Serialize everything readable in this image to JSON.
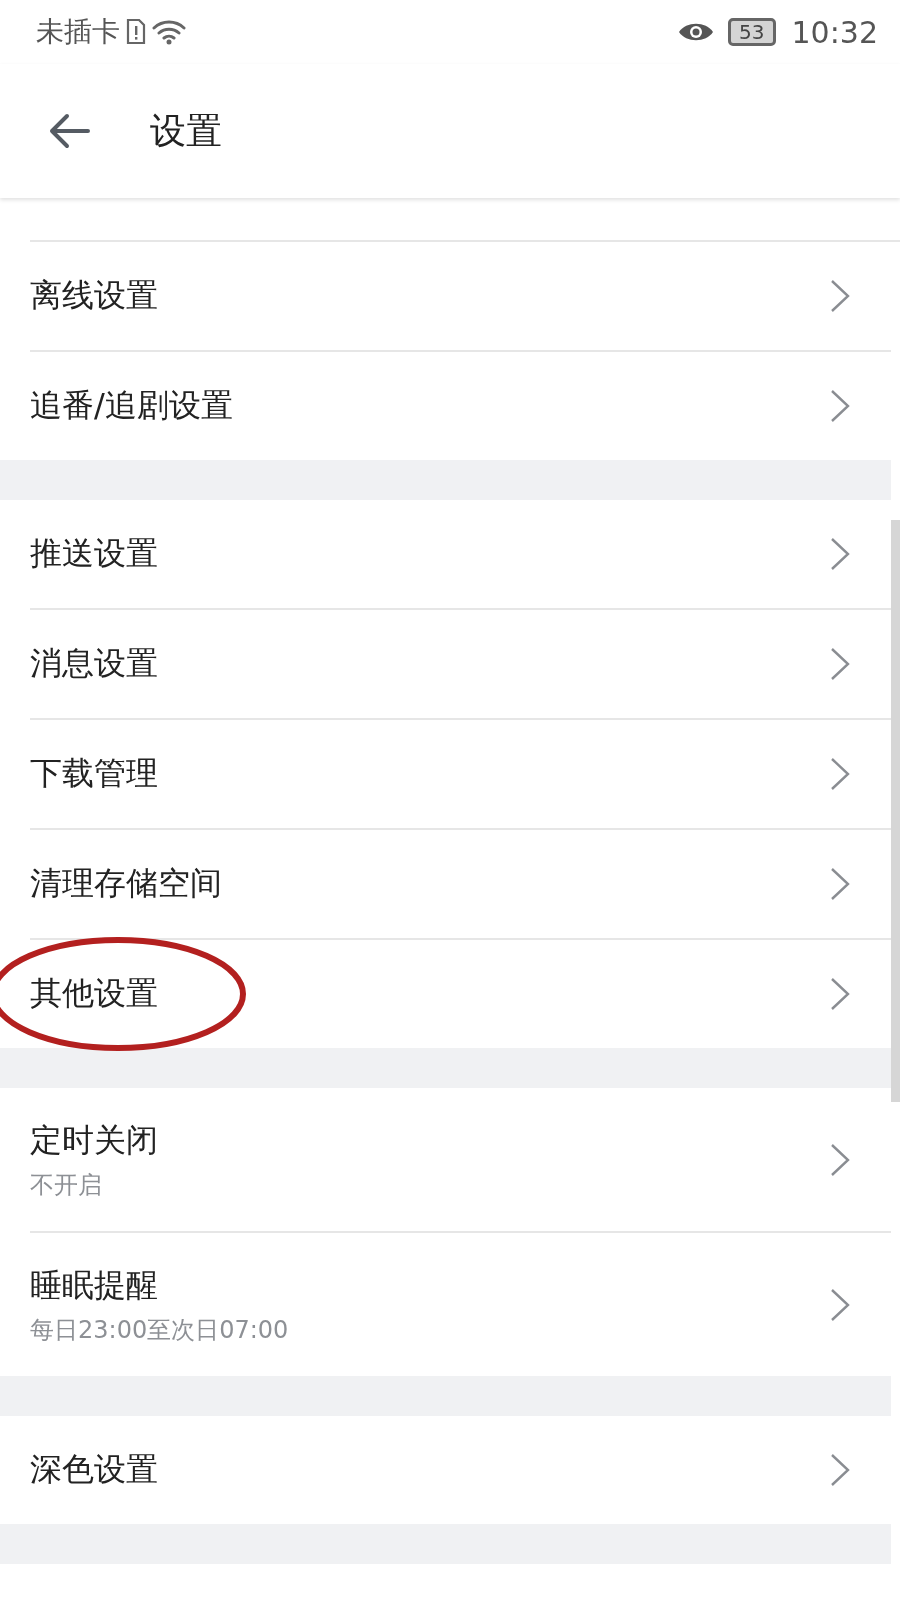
{
  "status_bar": {
    "carrier": "未插卡",
    "battery": "53",
    "time": "10:32"
  },
  "header": {
    "title": "设置"
  },
  "groups": [
    {
      "items": [
        {
          "label": "离线设置",
          "circled": false
        },
        {
          "label": "追番/追剧设置",
          "circled": false
        }
      ]
    },
    {
      "items": [
        {
          "label": "推送设置",
          "circled": false
        },
        {
          "label": "消息设置",
          "circled": false
        },
        {
          "label": "下载管理",
          "circled": false
        },
        {
          "label": "清理存储空间",
          "circled": false
        },
        {
          "label": "其他设置",
          "circled": true
        }
      ]
    },
    {
      "items": [
        {
          "label": "定时关闭",
          "sublabel": "不开启",
          "circled": false
        },
        {
          "label": "睡眠提醒",
          "sublabel": "每日23:00至次日07:00",
          "circled": false
        }
      ]
    },
    {
      "items": [
        {
          "label": "深色设置",
          "circled": false
        }
      ]
    }
  ]
}
